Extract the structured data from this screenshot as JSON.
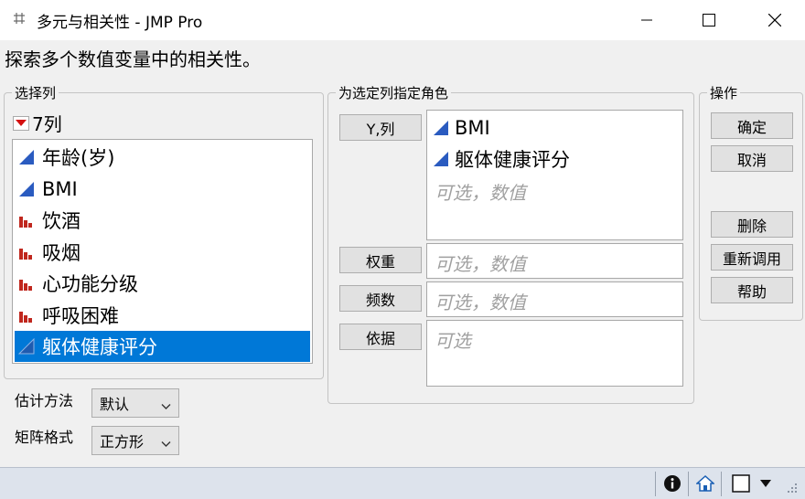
{
  "window": {
    "title": "多元与相关性 - JMP Pro",
    "app_icon": "grid-icon"
  },
  "instruction": "探索多个数值变量中的相关性。",
  "select_columns": {
    "group_title": "选择列",
    "count_label": "7列",
    "items": [
      {
        "label": "年龄(岁)",
        "icon": "continuous-icon"
      },
      {
        "label": "BMI",
        "icon": "continuous-icon"
      },
      {
        "label": "饮酒",
        "icon": "ordinal-icon"
      },
      {
        "label": "吸烟",
        "icon": "ordinal-icon"
      },
      {
        "label": "心功能分级",
        "icon": "ordinal-icon"
      },
      {
        "label": "呼吸困难",
        "icon": "ordinal-icon"
      },
      {
        "label": "躯体健康评分",
        "icon": "continuous-icon",
        "selected": true
      }
    ]
  },
  "roles": {
    "group_title": "为选定列指定角色",
    "y": {
      "button": "Y,列",
      "items": [
        "BMI",
        "躯体健康评分"
      ],
      "placeholder": "可选，数值"
    },
    "weight": {
      "button": "权重",
      "placeholder": "可选，数值"
    },
    "freq": {
      "button": "频数",
      "placeholder": "可选，数值"
    },
    "by": {
      "button": "依据",
      "placeholder": "可选"
    }
  },
  "actions": {
    "group_title": "操作",
    "ok": "确定",
    "cancel": "取消",
    "remove": "删除",
    "recall": "重新调用",
    "help": "帮助"
  },
  "options": {
    "estimation_label": "估计方法",
    "estimation_value": "默认",
    "matrix_label": "矩阵格式",
    "matrix_value": "正方形"
  },
  "statusbar": {
    "icons": [
      "info-icon",
      "home-icon",
      "window-list-icon",
      "dropdown-icon"
    ]
  },
  "colors": {
    "selection": "#0078d7",
    "continuous_icon": "#2a5bc0",
    "ordinal_icon": "#c0271e"
  }
}
